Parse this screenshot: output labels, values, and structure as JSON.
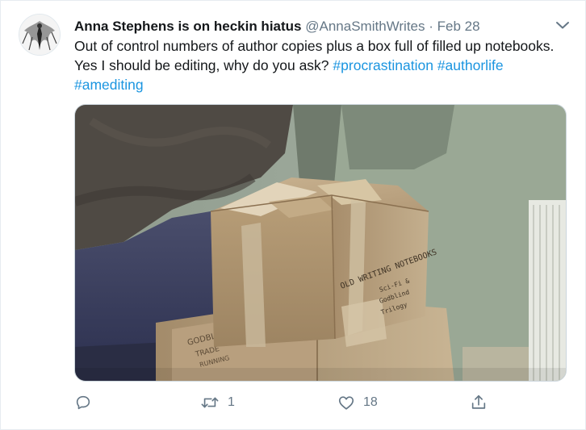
{
  "tweet": {
    "author_name": "Anna Stephens is on heckin hiatus",
    "handle": "@AnnaSmithWrites",
    "separator": "·",
    "date": "Feb 28",
    "text_main": "Out of control numbers of author copies plus a box full of filled up notebooks. Yes I should be editing, why do you ask?",
    "hashtags": [
      "#procrastination",
      "#authorlife",
      "#amediting"
    ]
  },
  "photo": {
    "box_writing": [
      "OLD WRITING NOTEBOOKS",
      "Sci-Fi &",
      "Godblind",
      "Trilogy"
    ],
    "lower_box_writing": [
      "GODBLIND",
      "TRADE",
      "RUNNING"
    ]
  },
  "actions": {
    "reply_count": "",
    "retweet_count": "1",
    "like_count": "18"
  },
  "icons": {
    "reply": "reply-icon",
    "retweet": "retweet-icon",
    "like": "heart-icon",
    "share": "share-icon",
    "menu": "chevron-down-icon"
  },
  "colors": {
    "hashtag": "#1b95e0",
    "meta": "#657786",
    "text": "#14171a"
  }
}
